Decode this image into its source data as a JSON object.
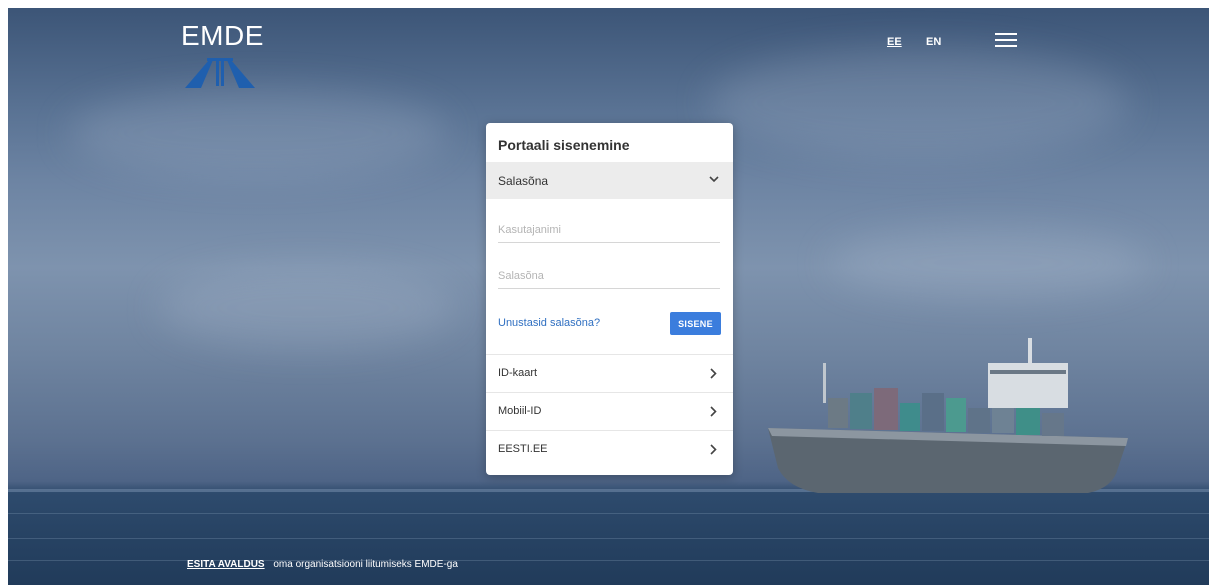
{
  "header": {
    "logo_text": "EMDE",
    "lang_ee": "EE",
    "lang_en": "EN"
  },
  "login": {
    "title": "Portaali sisenemine",
    "method_selected": "Salasõna",
    "username_placeholder": "Kasutajanimi",
    "password_placeholder": "Salasõna",
    "forgot_link": "Unustasid salasõna?",
    "submit_label": "SISENE",
    "options": [
      {
        "label": "ID-kaart"
      },
      {
        "label": "Mobiil-ID"
      },
      {
        "label": "EESTI.EE"
      }
    ]
  },
  "footer": {
    "link_label": "ESITA AVALDUS",
    "text": "oma organisatsiooni liitumiseks EMDE-ga"
  },
  "colors": {
    "accent": "#3b7ddd",
    "link": "#2f6fc1",
    "logo_mark": "#1f5fae"
  }
}
